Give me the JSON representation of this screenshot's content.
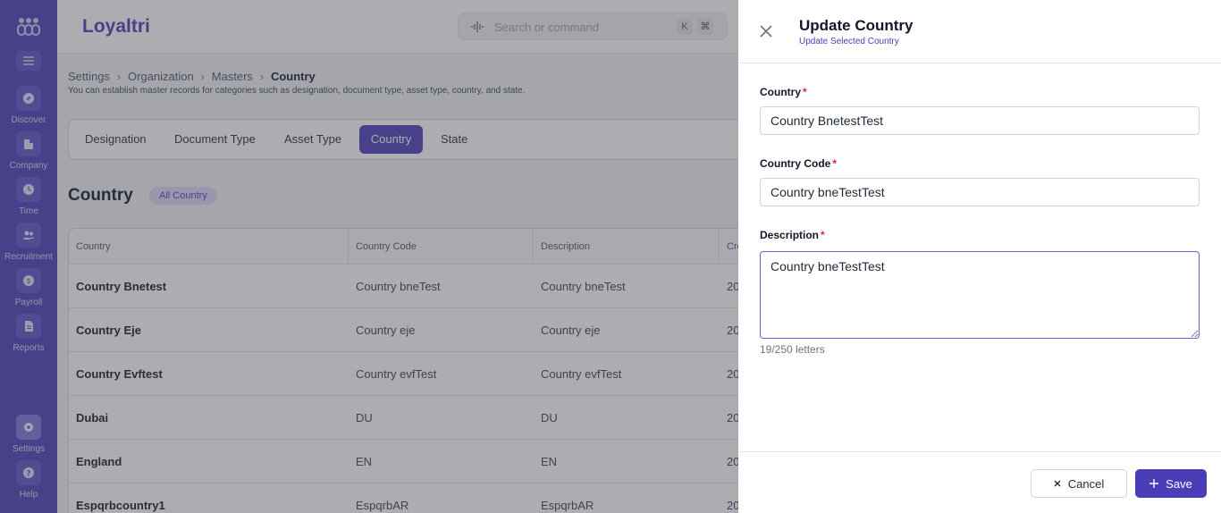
{
  "app": {
    "brand": "Loyaltri"
  },
  "search": {
    "placeholder": "Search or command",
    "kbd_k": "K",
    "kbd_cmd": "⌘"
  },
  "sidebar": {
    "items": [
      {
        "label": "Discover",
        "icon": "compass-icon"
      },
      {
        "label": "Company",
        "icon": "building-icon"
      },
      {
        "label": "Time",
        "icon": "clock-icon"
      },
      {
        "label": "Recruitment",
        "icon": "users-icon"
      },
      {
        "label": "Payroll",
        "icon": "dollar-icon"
      },
      {
        "label": "Reports",
        "icon": "document-icon"
      },
      {
        "label": "Settings",
        "icon": "gear-icon"
      },
      {
        "label": "Help",
        "icon": "question-icon"
      }
    ]
  },
  "breadcrumb": {
    "items": [
      "Settings",
      "Organization",
      "Masters",
      "Country"
    ]
  },
  "page": {
    "description": "You can establish master records for categories such as designation, document type, asset type, country, and state."
  },
  "tabs": [
    "Designation",
    "Document Type",
    "Asset Type",
    "Country",
    "State"
  ],
  "section": {
    "title": "Country",
    "badge": "All Country"
  },
  "table": {
    "headers": [
      "Country",
      "Country Code",
      "Description",
      "Cre"
    ],
    "rows": [
      {
        "country": "Country Bnetest",
        "code": "Country bneTest",
        "description": "Country bneTest",
        "created": "20"
      },
      {
        "country": "Country Eje",
        "code": "Country eje",
        "description": "Country eje",
        "created": "20"
      },
      {
        "country": "Country Evftest",
        "code": "Country evfTest",
        "description": "Country evfTest",
        "created": "20"
      },
      {
        "country": "Dubai",
        "code": "DU",
        "description": "DU",
        "created": "20"
      },
      {
        "country": "England",
        "code": "EN",
        "description": "EN",
        "created": "20"
      },
      {
        "country": "Espqrbcountry1",
        "code": "EspqrbAR",
        "description": "EspqrbAR",
        "created": "20"
      }
    ]
  },
  "drawer": {
    "title": "Update Country",
    "subtitle": "Update Selected Country",
    "fields": {
      "country": {
        "label": "Country",
        "required": "*",
        "value": "Country BnetestTest"
      },
      "code": {
        "label": "Country Code",
        "required": "*",
        "value": "Country bneTestTest"
      },
      "description": {
        "label": "Description",
        "required": "*",
        "value": "Country bneTestTest",
        "counter": "19/250 letters"
      }
    },
    "cancel_label": "Cancel",
    "save_label": "Save"
  },
  "colors": {
    "accent": "#4a3db8",
    "required": "#e11d48"
  }
}
